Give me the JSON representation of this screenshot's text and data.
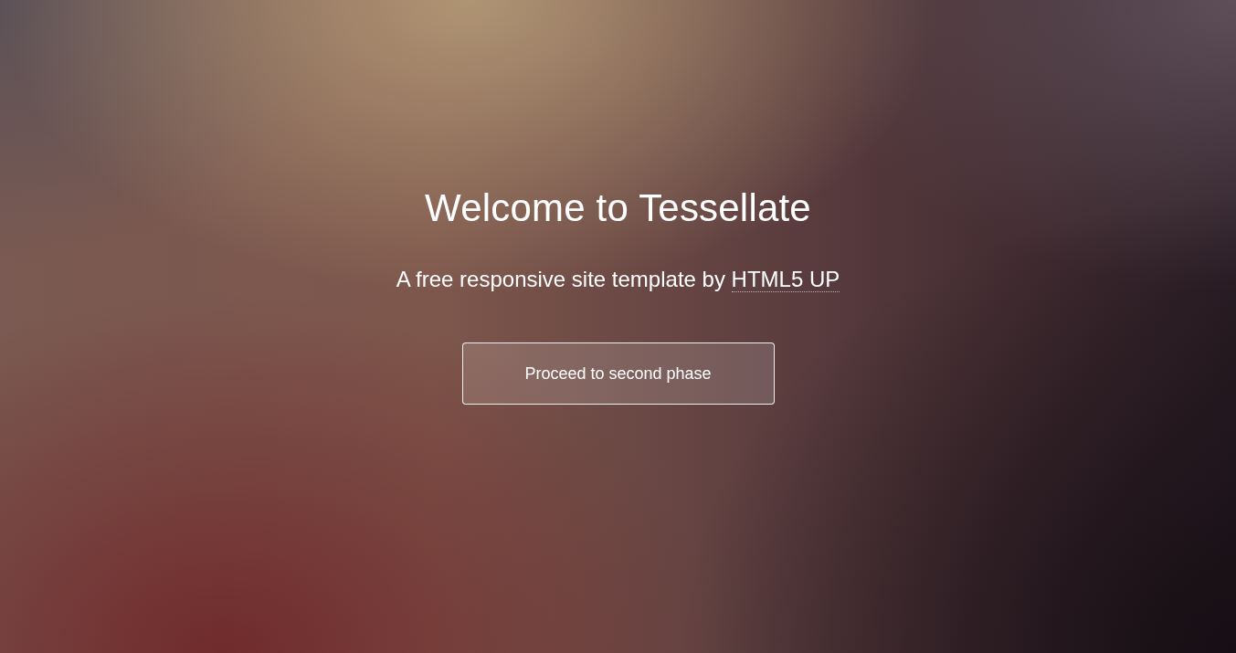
{
  "hero": {
    "title": "Welcome to Tessellate",
    "tagline": {
      "text": "A free responsive site template by",
      "link": "HTML5 UP"
    },
    "button": {
      "label": "Proceed to second phase"
    }
  }
}
